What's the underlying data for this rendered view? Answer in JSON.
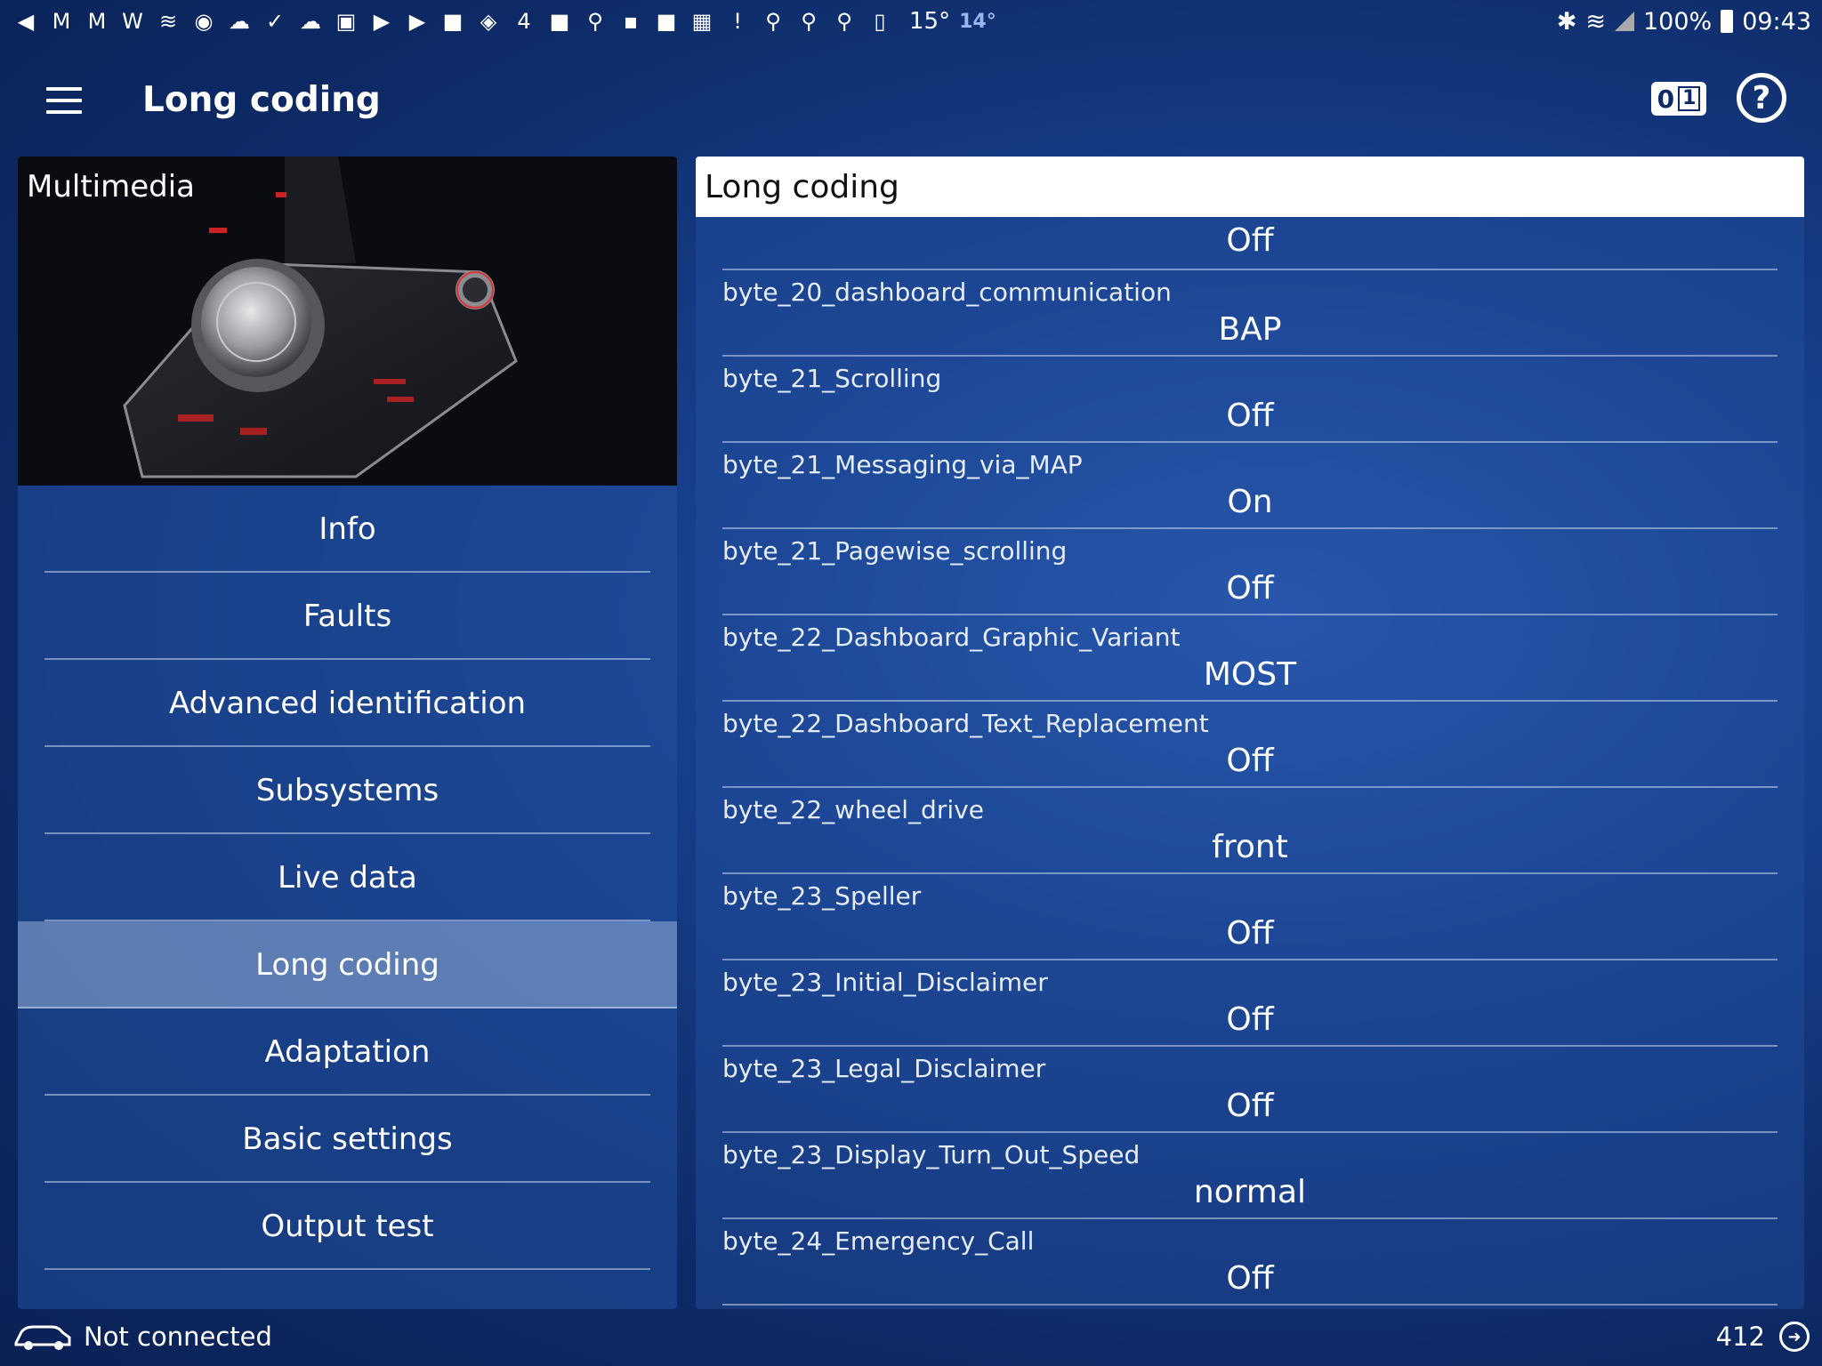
{
  "status_bar": {
    "icons": [
      "volume-icon",
      "gmail-icon",
      "gmail-icon",
      "w-icon",
      "layers-icon",
      "globe-icon",
      "cloud-sync-icon",
      "check-icon",
      "cloud-icon",
      "photo-icon",
      "youtube-icon",
      "youtube-icon",
      "flipboard-icon",
      "location-icon",
      "channel4-icon",
      "flipboard-icon",
      "map-pin-icon",
      "news-icon",
      "flipboard-icon",
      "calendar-icon",
      "alert-icon",
      "map-pin-icon",
      "map-pin-icon",
      "map-pin-icon",
      "phone-icon"
    ],
    "temperature": "15°",
    "temperature_secondary": "14°",
    "battery": "100%",
    "time": "09:43"
  },
  "app_bar": {
    "title": "Long coding",
    "binary_icon_left": "0",
    "binary_icon_right": "1",
    "help_symbol": "?"
  },
  "module": {
    "title": "Multimedia"
  },
  "nav": {
    "items": [
      {
        "label": "Info"
      },
      {
        "label": "Faults"
      },
      {
        "label": "Advanced identification"
      },
      {
        "label": "Subsystems"
      },
      {
        "label": "Live data"
      },
      {
        "label": "Long coding"
      },
      {
        "label": "Adaptation"
      },
      {
        "label": "Basic settings"
      },
      {
        "label": "Output test"
      }
    ],
    "active": "Long coding"
  },
  "coding": {
    "header": "Long coding",
    "first_partial_value": "Off",
    "rows": [
      {
        "name": "byte_20_dashboard_communication",
        "value": "BAP"
      },
      {
        "name": "byte_21_Scrolling",
        "value": "Off"
      },
      {
        "name": "byte_21_Messaging_via_MAP",
        "value": "On"
      },
      {
        "name": "byte_21_Pagewise_scrolling",
        "value": "Off"
      },
      {
        "name": "byte_22_Dashboard_Graphic_Variant",
        "value": "MOST"
      },
      {
        "name": "byte_22_Dashboard_Text_Replacement",
        "value": "Off"
      },
      {
        "name": "byte_22_wheel_drive",
        "value": "front"
      },
      {
        "name": "byte_23_Speller",
        "value": "Off"
      },
      {
        "name": "byte_23_Initial_Disclaimer",
        "value": "Off"
      },
      {
        "name": "byte_23_Legal_Disclaimer",
        "value": "Off"
      },
      {
        "name": "byte_23_Display_Turn_Out_Speed",
        "value": "normal"
      },
      {
        "name": "byte_24_Emergency_Call",
        "value": "Off"
      }
    ]
  },
  "footer": {
    "connection_status": "Not connected",
    "count": "412"
  }
}
